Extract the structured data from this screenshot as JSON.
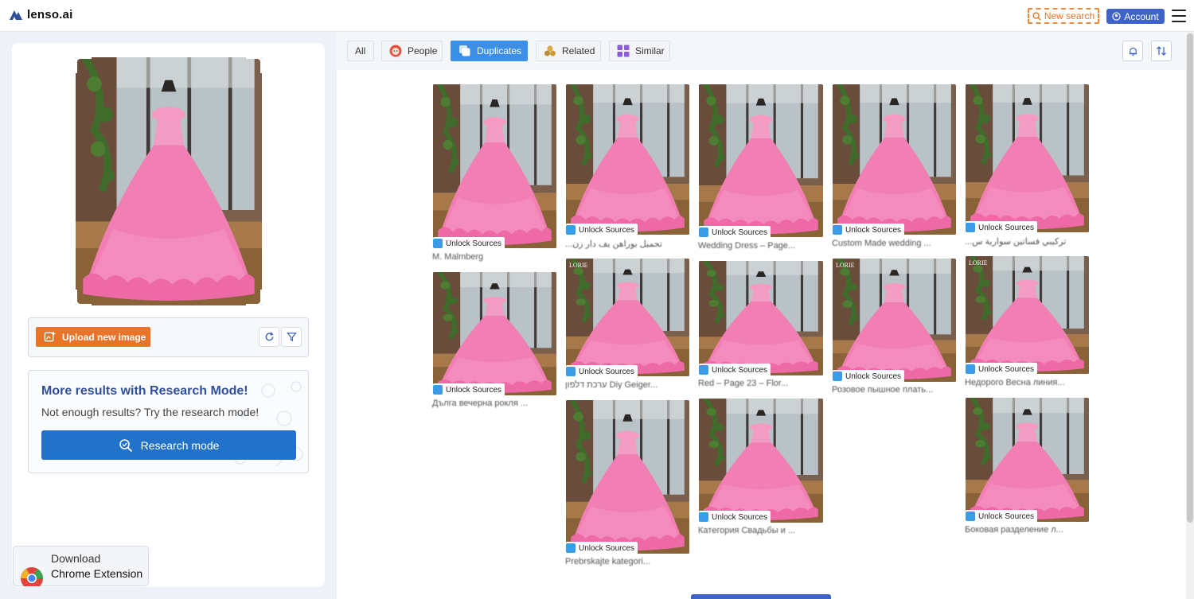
{
  "header": {
    "logo_text": "lenso.ai",
    "new_search_label": "New search",
    "account_label": "Account"
  },
  "upload": {
    "button_label": "Upload new image"
  },
  "research": {
    "title": "More results with Research Mode!",
    "subtitle": "Not enough results? Try the research mode!",
    "button_label": "Research mode"
  },
  "extension": {
    "line1": "Download",
    "line2": "Chrome Extension"
  },
  "tabs": [
    {
      "label": "All",
      "icon": "none"
    },
    {
      "label": "People",
      "icon": "face-icon"
    },
    {
      "label": "Duplicates",
      "icon": "duplicate-icon"
    },
    {
      "label": "Related",
      "icon": "related-icon"
    },
    {
      "label": "Similar",
      "icon": "similar-grid-icon"
    }
  ],
  "unlock_label": "Unlock Sources",
  "results": [
    {
      "caption": "M. Malmberg"
    },
    {
      "caption": "...تحميل بوراهن يف دار زن"
    },
    {
      "caption": "Wedding Dress – Page..."
    },
    {
      "caption": "Custom Made wedding ..."
    },
    {
      "caption": "...ترکيبي فساتين سوارية س"
    },
    {
      "caption": "Дълга вечерна рокля ..."
    },
    {
      "caption": "ערכת דלפון Diy Geiger..."
    },
    {
      "caption": "Red – Page 23 – Flor..."
    },
    {
      "caption": "Розовое пышное плать..."
    },
    {
      "caption": "Недорого Весна линия..."
    },
    {
      "caption": "Prebrskajte kategori..."
    },
    {
      "caption": "Категория Свадьбы и ..."
    },
    {
      "caption": "Боковая разделение л..."
    }
  ],
  "watermark_text": "LORIE",
  "colors": {
    "accent_orange": "#e8742a",
    "brand_blue": "#3e63c8",
    "research_button": "#2372c9",
    "active_tab": "#3b8fe6",
    "dress_pink": "#f27fb4"
  }
}
